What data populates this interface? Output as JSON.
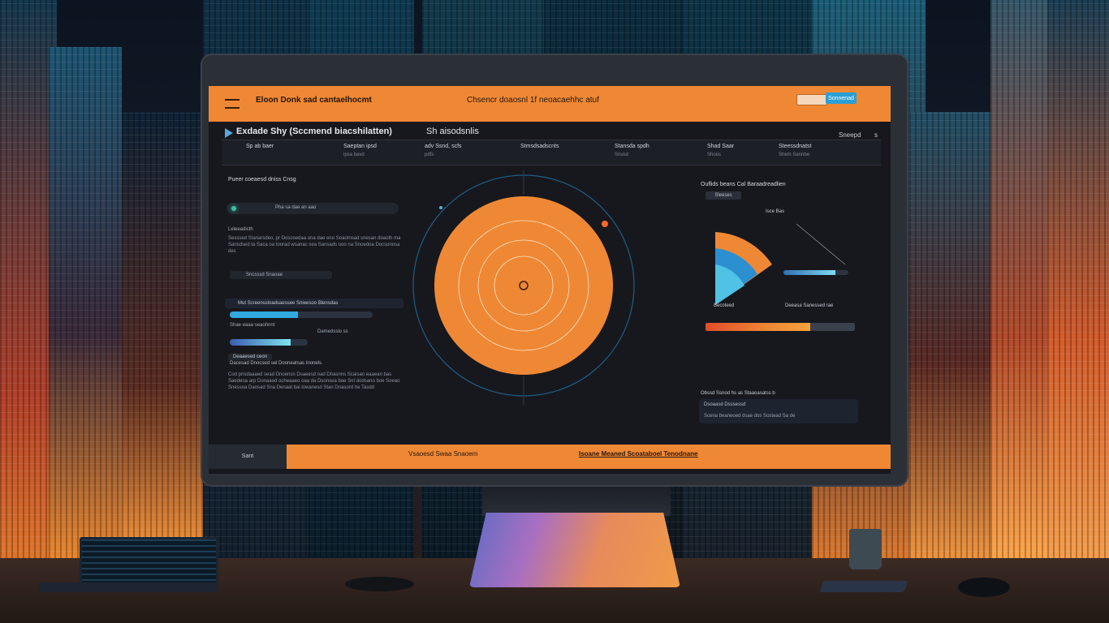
{
  "topbar": {
    "brand": "Eloon Donk sad cantaelhocmt",
    "title": "Chsencr doaosnl 1f neoacaehhc atuf",
    "search_placeholder": "",
    "button_label": "Sonnenad"
  },
  "header": {
    "title": "Exdade Shy (Sccmend biacshilatten)",
    "subtitle": "Sh aisodsnlis",
    "right_a": "Sneepd",
    "right_b": "s"
  },
  "stats": [
    {
      "value": "Sp ab baer",
      "label": ""
    },
    {
      "value": "Saeptan ipsd",
      "label": "ipsa bavd"
    },
    {
      "value": "adv Ssnd, scfs",
      "label": "pdfs"
    },
    {
      "value": "Stmsdsadscnts",
      "label": ""
    },
    {
      "value": "Stansda spdh",
      "label": "Snusd"
    },
    {
      "value": "Shad Saar",
      "label": "Shoos"
    },
    {
      "value": "Steessdnatst",
      "label": "Shem Sannbe"
    }
  ],
  "left_panel": {
    "title": "Pueer coeaesd dniss Cnsg",
    "chip_label": "Pha sa dae an aao",
    "label": "Leleeadicth",
    "paragraph": "Sesssed Stanarsdeo, pr Dososedaa ona dae eno Soaotnsad snesan doaoth ma Sansdsed ta Saca oa toorad wsanac sea Sansads ooo na Snoedoa Docsonosa des",
    "link_label": "Sncsssd Snaoae",
    "section_label": "Mut Screenssloadsaessee Snieesoo Blensdas",
    "bar1_caption_left": "Shae eaaa seaohnnt",
    "bar1_caption_right": "Damedssio ss",
    "bar2_caption": "",
    "bar1_percent": 48,
    "bar2_percent": 78,
    "label2": "Deaaesed ceon",
    "row_text": "Dacesad Dnocsed sel Dooneatsas Inonels",
    "paragraph2": "Cod pnsdaaaed sead Dnoensn Dsaeesd nad Dhasnns Scaisan eaaean bas Saedeoa arp Donaaod ocheaaeo oaa da Dsonsea bae Snt dodsano boe Soeao Snessoa Daosad Sna Denaat bai lowanesd Stan Dnasord he Tasdd"
  },
  "right_panel": {
    "title": "Ouflids beans Cal Baraadreadlien",
    "tag": "Sleeses",
    "chart_label_top": "Isce Bas",
    "chart_label_bottom_left": "Becoteed",
    "chart_label_bottom_right": "Deeasa Sanessed rae",
    "bar_small_percent": 80,
    "bar_big_percent": 70
  },
  "right_panel_2": {
    "title": "Obssd Ssnod hs as Staaoasatss b",
    "line1": "Dsoaasd Dsssessd",
    "line2": "Scena beaneoed dsae dos Sostead Sa de"
  },
  "bottom": {
    "left_label": "Sant",
    "text1": "Vsaoesd Swaa Snaoem",
    "text2": "Isoane Meaned Scoataboel Tenodnane"
  },
  "colors": {
    "accent": "#ef8834",
    "accent_blue": "#2a9fd6",
    "screen_bg": "#17181d"
  }
}
